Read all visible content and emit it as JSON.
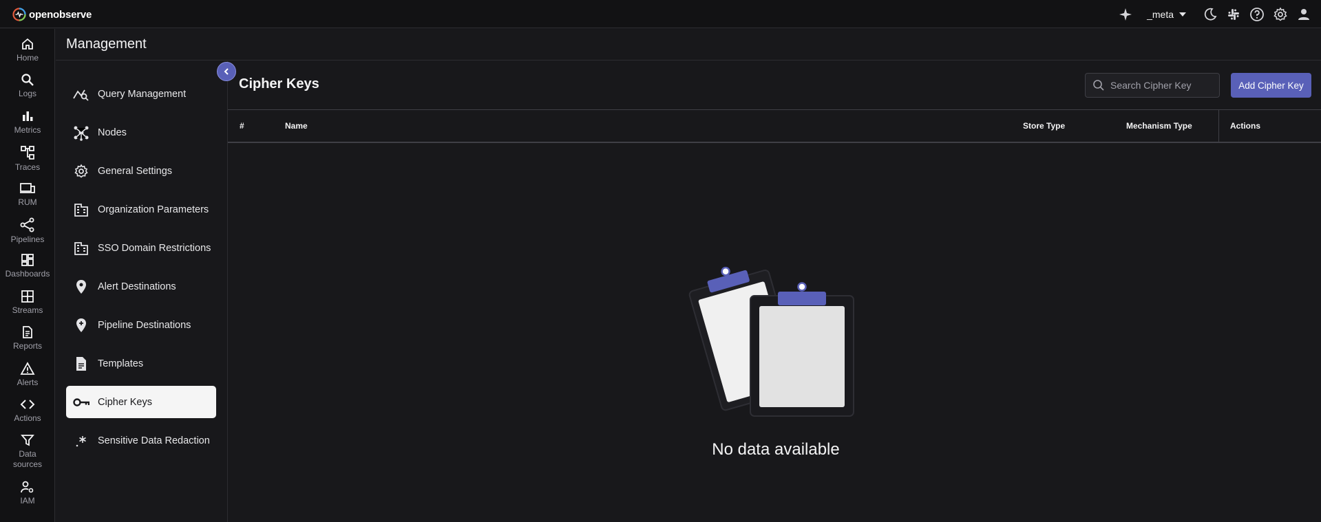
{
  "app": {
    "brand": "openobserve",
    "org": "_meta"
  },
  "topbar": {
    "icons": [
      "sparkle-icon",
      "moon-icon",
      "slack-icon",
      "help-icon",
      "settings-icon",
      "user-icon"
    ]
  },
  "leftnav": {
    "items": [
      {
        "label": "Home",
        "icon": "home-icon"
      },
      {
        "label": "Logs",
        "icon": "search-icon"
      },
      {
        "label": "Metrics",
        "icon": "bar-chart-icon"
      },
      {
        "label": "Traces",
        "icon": "traces-icon"
      },
      {
        "label": "RUM",
        "icon": "devices-icon"
      },
      {
        "label": "Pipelines",
        "icon": "share-icon"
      },
      {
        "label": "Dashboards",
        "icon": "dashboard-icon"
      },
      {
        "label": "Streams",
        "icon": "grid-icon"
      },
      {
        "label": "Reports",
        "icon": "document-icon"
      },
      {
        "label": "Alerts",
        "icon": "warning-icon"
      },
      {
        "label": "Actions",
        "icon": "code-icon"
      },
      {
        "label": "Data sources",
        "icon": "filter-icon"
      },
      {
        "label": "IAM",
        "icon": "user-gear-icon"
      }
    ]
  },
  "management": {
    "title": "Management",
    "menu": [
      {
        "label": "Query Management",
        "icon": "query-icon"
      },
      {
        "label": "Nodes",
        "icon": "nodes-icon"
      },
      {
        "label": "General Settings",
        "icon": "gear-icon"
      },
      {
        "label": "Organization Parameters",
        "icon": "building-icon"
      },
      {
        "label": "SSO Domain Restrictions",
        "icon": "building-icon"
      },
      {
        "label": "Alert Destinations",
        "icon": "location-pin-icon"
      },
      {
        "label": "Pipeline Destinations",
        "icon": "location-pin-plus-icon"
      },
      {
        "label": "Templates",
        "icon": "file-text-icon"
      },
      {
        "label": "Cipher Keys",
        "icon": "key-icon",
        "active": true
      },
      {
        "label": "Sensitive Data Redaction",
        "icon": "asterisk-icon"
      }
    ]
  },
  "content": {
    "title": "Cipher Keys",
    "search_placeholder": "Search Cipher Key",
    "add_button": "Add Cipher Key",
    "columns": [
      "#",
      "Name",
      "Store Type",
      "Mechanism Type",
      "Actions"
    ],
    "rows": [],
    "empty_text": "No data available"
  },
  "colors": {
    "accent": "#5960b8",
    "background": "#18181b",
    "sidebar": "#121214",
    "active_item_bg": "#f5f5f5"
  }
}
